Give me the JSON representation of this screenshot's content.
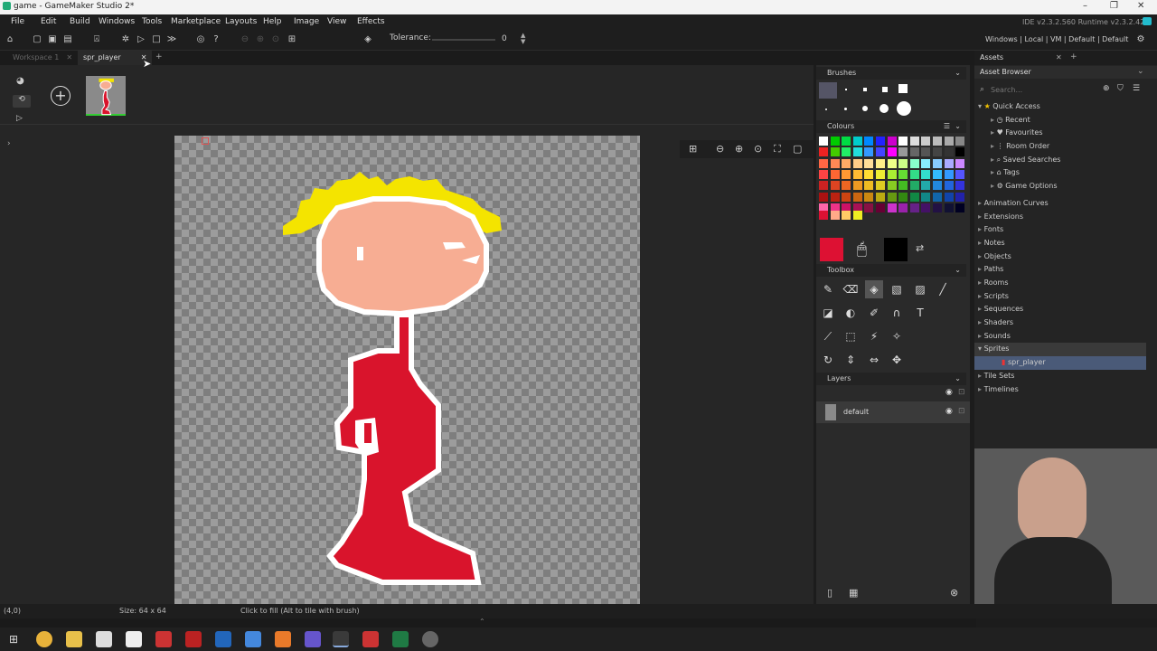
{
  "window": {
    "title": "game - GameMaker Studio 2*",
    "minimize": "–",
    "maximize": "❐",
    "close": "✕"
  },
  "menu": [
    "File",
    "Edit",
    "Build",
    "Windows",
    "Tools",
    "Marketplace",
    "Layouts",
    "Help",
    "Image",
    "View",
    "Effects"
  ],
  "version_info": "IDE v2.3.2.560  Runtime v2.3.2.426",
  "toolbar": {
    "tolerance_label": "Tolerance:",
    "tolerance_value": "0"
  },
  "targets": "Windows | Local | VM | Default | Default",
  "tabs": [
    {
      "label": "Workspace 1"
    },
    {
      "label": "spr_player"
    }
  ],
  "add_frame": "+",
  "panels": {
    "brushes": "Brushes",
    "colours": "Colours",
    "toolbox": "Toolbox",
    "layers": "Layers"
  },
  "palette_colors": [
    [
      "#ffffff",
      "#00cc00",
      "#00dd44",
      "#00cccc",
      "#0088ff",
      "#2222ff",
      "#cc00cc",
      "#ffffff",
      "#dddddd",
      "#cccccc",
      "#bbbbbb",
      "#aaaaaa",
      "#888888"
    ],
    [
      "#ee2222",
      "#44cc00",
      "#22ee66",
      "#22dddd",
      "#3399ff",
      "#4444ff",
      "#ff00ff",
      "#999999",
      "#666666",
      "#555555",
      "#444444",
      "#333333",
      "#000000"
    ],
    [
      "#ff6644",
      "#ff8855",
      "#ffaa66",
      "#ffcc88",
      "#ffdd99",
      "#ffee88",
      "#eeff88",
      "#ccff88",
      "#88ffcc",
      "#88eeff",
      "#88ccff",
      "#aaaaff",
      "#cc88ff"
    ],
    [
      "#ff4444",
      "#ff6633",
      "#ff9933",
      "#ffbb33",
      "#ffdd33",
      "#eeee33",
      "#aaee33",
      "#66dd33",
      "#33dd88",
      "#33ddcc",
      "#33bbff",
      "#3399ff",
      "#5555ff"
    ],
    [
      "#cc2222",
      "#dd4422",
      "#ee6622",
      "#ee9922",
      "#eebb22",
      "#ddcc22",
      "#88cc22",
      "#44bb22",
      "#22aa66",
      "#22aaaa",
      "#2288dd",
      "#2266dd",
      "#3333dd"
    ],
    [
      "#aa1111",
      "#bb2211",
      "#cc4411",
      "#cc6611",
      "#cc8811",
      "#bbaa11",
      "#669911",
      "#338811",
      "#118844",
      "#118888",
      "#1166aa",
      "#1144aa",
      "#2222aa"
    ],
    [
      "#ff66aa",
      "#ee3388",
      "#cc1166",
      "#aa1155",
      "#881144",
      "#660033",
      "#cc33cc",
      "#9922aa",
      "#662288",
      "#441166",
      "#221144",
      "#111133",
      "#000022"
    ]
  ],
  "recent_colors": [
    "#dd1133",
    "#ffaa88",
    "#ffcc66",
    "#eeee22"
  ],
  "primary_color": "#dd1133",
  "secondary_color": "#000000",
  "layers": [
    {
      "name": "default"
    }
  ],
  "assets": {
    "title": "Assets",
    "browser": "Asset Browser",
    "search_placeholder": "Search...",
    "quick_access": "Quick Access",
    "quick_items": [
      "Recent",
      "Favourites",
      "Room Order",
      "Saved Searches",
      "Tags",
      "Game Options"
    ],
    "groups": [
      "Animation Curves",
      "Extensions",
      "Fonts",
      "Notes",
      "Objects",
      "Paths",
      "Rooms",
      "Scripts",
      "Sequences",
      "Shaders",
      "Sounds",
      "Sprites"
    ],
    "sprite_child": "spr_player",
    "after": [
      "Tile Sets",
      "Timelines"
    ]
  },
  "status": {
    "coords": "(4,0)",
    "size": "Size: 64 x 64",
    "hint": "Click to fill (Alt to tile with brush)"
  }
}
